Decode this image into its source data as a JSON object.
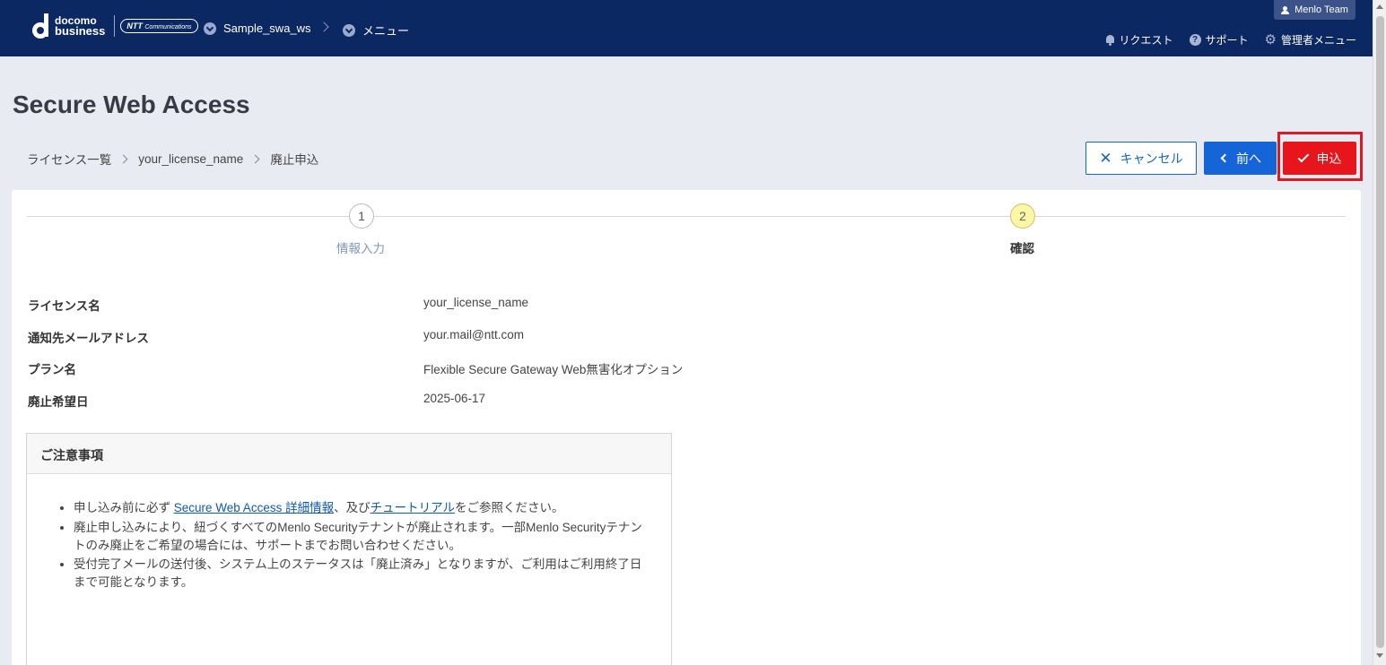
{
  "header": {
    "logo": {
      "line1": "docomo",
      "line2": "business",
      "partner": "NTT",
      "partner_sub": "Communications"
    },
    "breadcrumb": [
      "Sample_swa_ws",
      "メニュー"
    ],
    "user": "Menlo Team",
    "links": {
      "request": "リクエスト",
      "support": "サポート",
      "admin": "管理者メニュー"
    }
  },
  "page": {
    "title": "Secure Web Access",
    "breadcrumb": [
      "ライセンス一覧",
      "your_license_name",
      "廃止申込"
    ]
  },
  "buttons": {
    "cancel": "キャンセル",
    "prev": "前へ",
    "submit": "申込"
  },
  "steps": [
    {
      "number": "1",
      "label": "情報入力"
    },
    {
      "number": "2",
      "label": "確認"
    }
  ],
  "fields": [
    {
      "label": "ライセンス名",
      "value": "your_license_name"
    },
    {
      "label": "通知先メールアドレス",
      "value": "your.mail@ntt.com"
    },
    {
      "label": "プラン名",
      "value": "Flexible Secure Gateway Web無害化オプション"
    },
    {
      "label": "廃止希望日",
      "value": "2025-06-17"
    }
  ],
  "notice": {
    "title": "ご注意事項",
    "item1_prefix": "申し込み前に必ず ",
    "item1_link1": "Secure Web Access 詳細情報",
    "item1_mid": "、及び",
    "item1_link2": "チュートリアル",
    "item1_suffix": "をご参照ください。",
    "item2": "廃止申し込みにより、紐づくすべてのMenlo Securityテナントが廃止されます。一部Menlo Securityテナントのみ廃止をご希望の場合には、サポートまでお問い合わせください。",
    "item3": "受付完了メールの送付後、システム上のステータスは「廃止済み」となりますが、ご利用はご利用終了日まで可能となります。"
  }
}
